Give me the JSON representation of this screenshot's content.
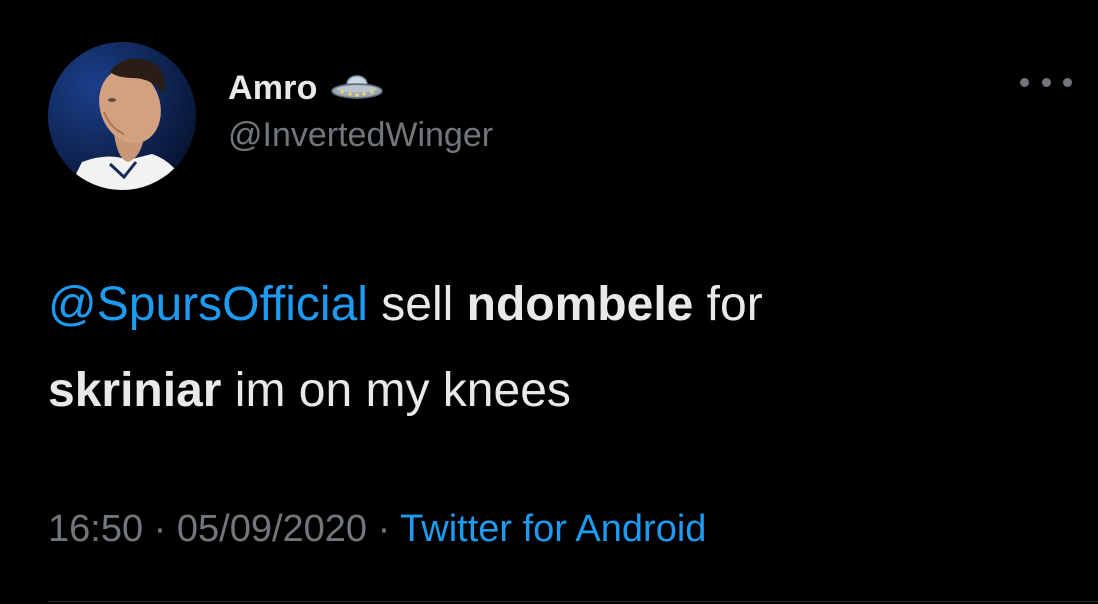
{
  "user": {
    "display_name": "Amro",
    "handle": "@InvertedWinger",
    "name_emoji": "flying-saucer-icon"
  },
  "tweet": {
    "segments": [
      {
        "text": "@SpursOfficial",
        "style": "mention"
      },
      {
        "text": " sell ",
        "style": "normal"
      },
      {
        "text": "ndombele",
        "style": "bold"
      },
      {
        "text": " for ",
        "style": "normal"
      },
      {
        "text": "skriniar",
        "style": "bold"
      },
      {
        "text": " im on my knees",
        "style": "normal"
      }
    ]
  },
  "meta": {
    "time": "16:50",
    "separator": " · ",
    "date": "05/09/2020",
    "source": "Twitter for Android"
  },
  "icons": {
    "more": "more-horizontal-icon"
  },
  "colors": {
    "background": "#000000",
    "text": "#e7e9ea",
    "secondary": "#71767b",
    "accent": "#1d9bf0"
  }
}
